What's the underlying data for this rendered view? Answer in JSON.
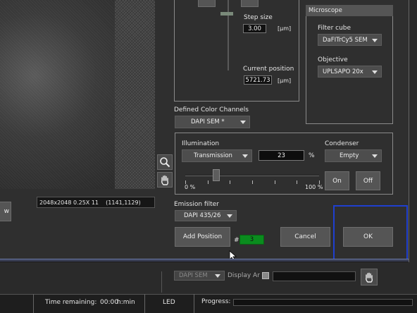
{
  "image_info": "2048x2048 0.25X 11    (1141,1129)",
  "left_button_partial": "w",
  "z_panel": {
    "step_size_label": "Step size",
    "step_size_value": "3.00",
    "step_size_unit": "[µm]",
    "current_position_label": "Current position",
    "current_position_value": "5721.73",
    "current_position_unit": "[µm]"
  },
  "microscope": {
    "title": "Microscope",
    "filter_cube_label": "Filter cube",
    "filter_cube_value": "DaFITrCy5 SEM",
    "objective_label": "Objective",
    "objective_value": "UPLSAPO 20x"
  },
  "channels": {
    "label": "Defined Color Channels",
    "value": "DAPI SEM *"
  },
  "illumination": {
    "label": "Illumination",
    "mode": "Transmission",
    "intensity": "23",
    "unit": "%",
    "min_label": "0 %",
    "max_label": "100 %",
    "level": 0.23
  },
  "condenser": {
    "label": "Condenser",
    "value": "Empty",
    "on_label": "On",
    "off_label": "Off"
  },
  "emission": {
    "label": "Emission filter",
    "value": "DAPI 435/26"
  },
  "position": {
    "add_label": "Add Position",
    "hash": "#",
    "count": "3"
  },
  "dialog": {
    "cancel_label": "Cancel",
    "ok_label": "OK"
  },
  "background_row": {
    "channel_value": "DAPI SEM",
    "display_label": "Display Ar"
  },
  "status_bar": {
    "time_remaining_label": "Time remaining:",
    "time_value": "00:00",
    "time_unit": "h:min",
    "led_label": "LED",
    "progress_label": "Progress:"
  }
}
